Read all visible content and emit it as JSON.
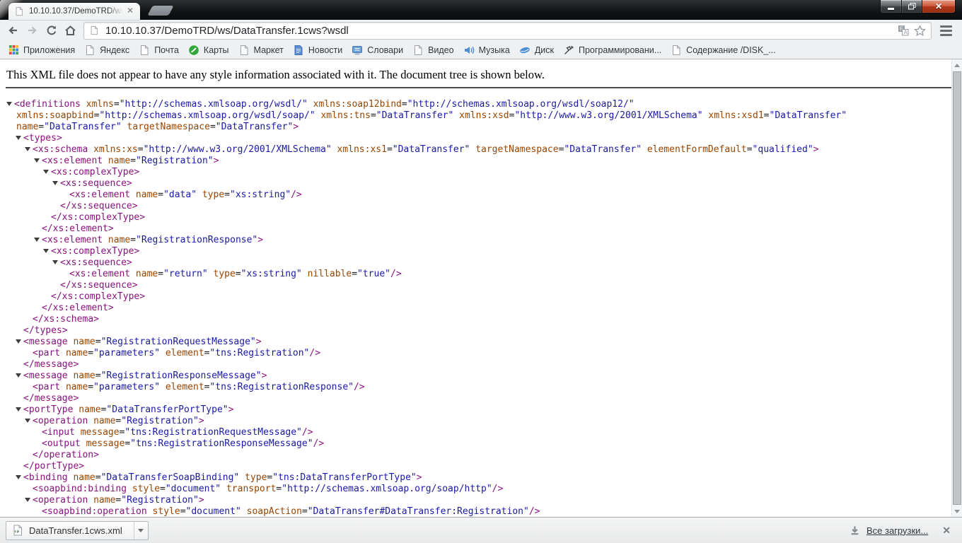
{
  "tab": {
    "title": "10.10.10.37/DemoTRD/ws"
  },
  "toolbar": {
    "url": "10.10.10.37/DemoTRD/ws/DataTransfer.1cws?wsdl"
  },
  "icons": {
    "tab_favicon": "page-icon",
    "omnibox_favicon": "page-icon",
    "toolbar": [
      "back-arrow-icon",
      "forward-arrow-icon",
      "reload-icon",
      "home-icon",
      "translate-icon",
      "bookmark-star-icon",
      "menu-icon"
    ],
    "window": [
      "minimize-icon",
      "restore-icon",
      "close-icon"
    ],
    "download_bar": [
      "xml-file-icon",
      "caret-down-icon",
      "download-arrow-icon",
      "close-icon"
    ]
  },
  "bookmarks": [
    {
      "label": "Приложения",
      "icon": "apps-grid-icon"
    },
    {
      "label": "Яндекс",
      "icon": "page-icon"
    },
    {
      "label": "Почта",
      "icon": "page-icon"
    },
    {
      "label": "Карты",
      "icon": "maps-icon"
    },
    {
      "label": "Маркет",
      "icon": "page-icon"
    },
    {
      "label": "Новости",
      "icon": "news-doc-icon"
    },
    {
      "label": "Словари",
      "icon": "dictionary-icon"
    },
    {
      "label": "Видео",
      "icon": "page-icon"
    },
    {
      "label": "Музыка",
      "icon": "music-icon"
    },
    {
      "label": "Диск",
      "icon": "disk-icon"
    },
    {
      "label": "Программировани...",
      "icon": "dev-icon"
    },
    {
      "label": "Содержание /DISK_...",
      "icon": "page-icon"
    }
  ],
  "page": {
    "notice": "This XML file does not appear to have any style information associated with it. The document tree is shown below.",
    "syntax_colors": {
      "tag": "#881280",
      "attribute": "#994500",
      "value": "#1a1aa6"
    },
    "xml_lines": [
      {
        "i": 0,
        "a": true,
        "t": "<definitions xmlns=\"http://schemas.xmlsoap.org/wsdl/\" xmlns:soap12bind=\"http://schemas.xmlsoap.org/wsdl/soap12/\""
      },
      {
        "i": 0,
        "c": true,
        "t": "xmlns:soapbind=\"http://schemas.xmlsoap.org/wsdl/soap/\" xmlns:tns=\"DataTransfer\" xmlns:xsd=\"http://www.w3.org/2001/XMLSchema\" xmlns:xsd1=\"DataTransfer\""
      },
      {
        "i": 0,
        "c": true,
        "t": "name=\"DataTransfer\" targetNamespace=\"DataTransfer\">"
      },
      {
        "i": 1,
        "a": true,
        "t": "<types>"
      },
      {
        "i": 2,
        "a": true,
        "t": "<xs:schema xmlns:xs=\"http://www.w3.org/2001/XMLSchema\" xmlns:xs1=\"DataTransfer\" targetNamespace=\"DataTransfer\" elementFormDefault=\"qualified\">"
      },
      {
        "i": 3,
        "a": true,
        "t": "<xs:element name=\"Registration\">"
      },
      {
        "i": 4,
        "a": true,
        "t": "<xs:complexType>"
      },
      {
        "i": 5,
        "a": true,
        "t": "<xs:sequence>"
      },
      {
        "i": 6,
        "t": "<xs:element name=\"data\" type=\"xs:string\"/>"
      },
      {
        "i": 5,
        "t": "</xs:sequence>"
      },
      {
        "i": 4,
        "t": "</xs:complexType>"
      },
      {
        "i": 3,
        "t": "</xs:element>"
      },
      {
        "i": 3,
        "a": true,
        "t": "<xs:element name=\"RegistrationResponse\">"
      },
      {
        "i": 4,
        "a": true,
        "t": "<xs:complexType>"
      },
      {
        "i": 5,
        "a": true,
        "t": "<xs:sequence>"
      },
      {
        "i": 6,
        "t": "<xs:element name=\"return\" type=\"xs:string\" nillable=\"true\"/>"
      },
      {
        "i": 5,
        "t": "</xs:sequence>"
      },
      {
        "i": 4,
        "t": "</xs:complexType>"
      },
      {
        "i": 3,
        "t": "</xs:element>"
      },
      {
        "i": 2,
        "t": "</xs:schema>"
      },
      {
        "i": 1,
        "t": "</types>"
      },
      {
        "i": 1,
        "a": true,
        "t": "<message name=\"RegistrationRequestMessage\">"
      },
      {
        "i": 2,
        "t": "<part name=\"parameters\" element=\"tns:Registration\"/>"
      },
      {
        "i": 1,
        "t": "</message>"
      },
      {
        "i": 1,
        "a": true,
        "t": "<message name=\"RegistrationResponseMessage\">"
      },
      {
        "i": 2,
        "t": "<part name=\"parameters\" element=\"tns:RegistrationResponse\"/>"
      },
      {
        "i": 1,
        "t": "</message>"
      },
      {
        "i": 1,
        "a": true,
        "t": "<portType name=\"DataTransferPortType\">"
      },
      {
        "i": 2,
        "a": true,
        "t": "<operation name=\"Registration\">"
      },
      {
        "i": 3,
        "t": "<input message=\"tns:RegistrationRequestMessage\"/>"
      },
      {
        "i": 3,
        "t": "<output message=\"tns:RegistrationResponseMessage\"/>"
      },
      {
        "i": 2,
        "t": "</operation>"
      },
      {
        "i": 1,
        "t": "</portType>"
      },
      {
        "i": 1,
        "a": true,
        "t": "<binding name=\"DataTransferSoapBinding\" type=\"tns:DataTransferPortType\">"
      },
      {
        "i": 2,
        "t": "<soapbind:binding style=\"document\" transport=\"http://schemas.xmlsoap.org/soap/http\"/>"
      },
      {
        "i": 2,
        "a": true,
        "t": "<operation name=\"Registration\">"
      },
      {
        "i": 3,
        "t": "<soapbind:operation style=\"document\" soapAction=\"DataTransfer#DataTransfer:Registration\"/>"
      }
    ]
  },
  "download_bar": {
    "filename": "DataTransfer.1cws.xml",
    "all_downloads_label": "Все загрузки..."
  }
}
